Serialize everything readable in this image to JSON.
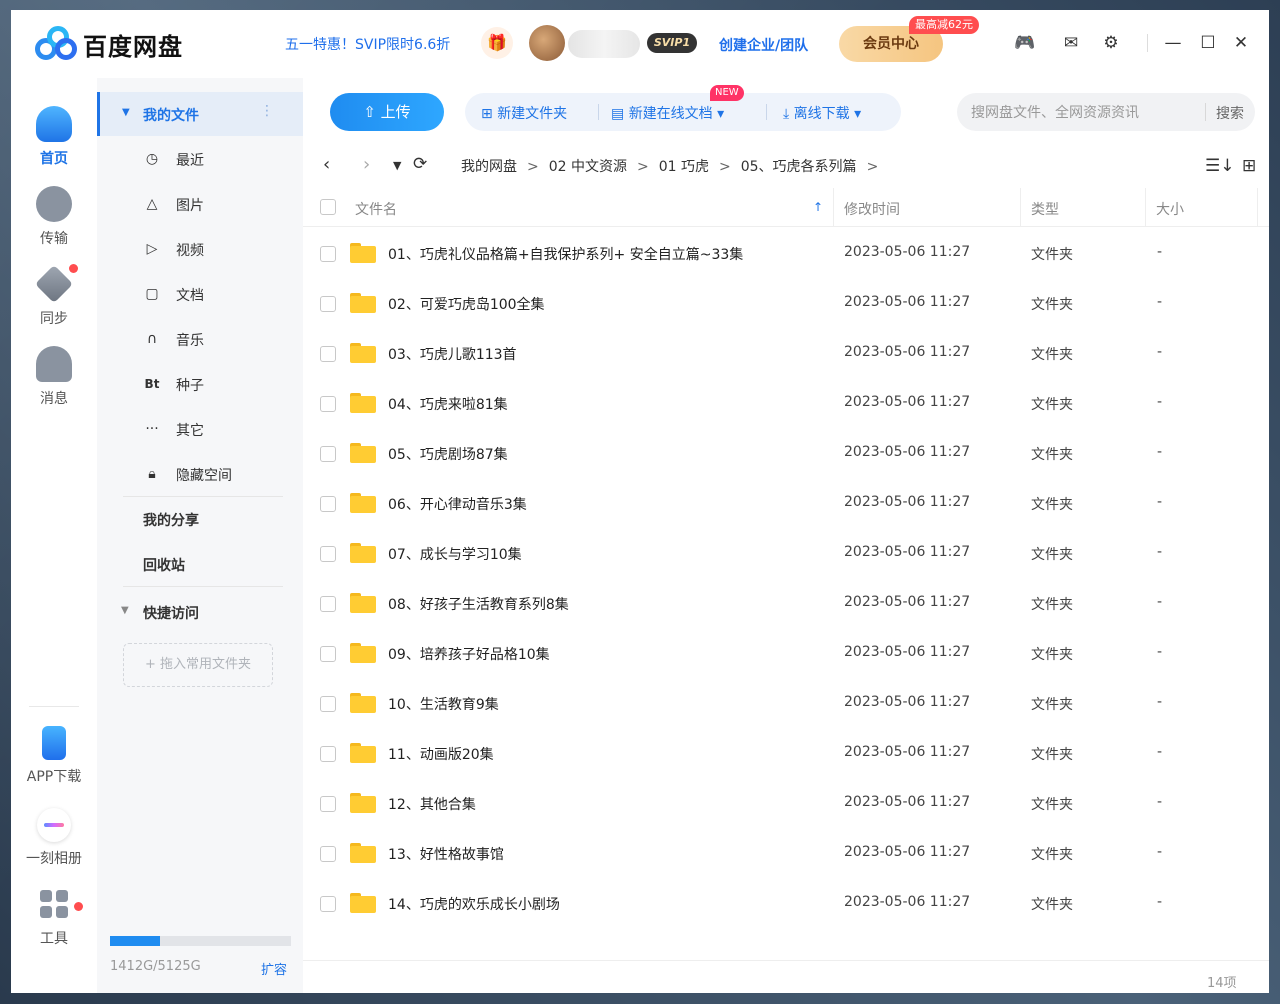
{
  "app": {
    "title": "百度网盘"
  },
  "topbar": {
    "promo": "五一特惠！SVIP限时6.6折",
    "svip_badge": "SVIP1",
    "enterprise": "创建企业/团队",
    "member_center": "会员中心",
    "member_badge": "最高减62元",
    "icons": [
      "gift-icon",
      "game-icon",
      "mail-icon",
      "gear-icon",
      "minimize-icon",
      "maximize-icon",
      "close-icon"
    ]
  },
  "leftnav": {
    "items": [
      {
        "label": "首页",
        "icon": "cloud-home-icon",
        "active": true
      },
      {
        "label": "传输",
        "icon": "transfer-icon"
      },
      {
        "label": "同步",
        "icon": "sync-icon",
        "dot": true
      },
      {
        "label": "消息",
        "icon": "users-icon"
      }
    ],
    "bottom": [
      {
        "label": "APP下载",
        "icon": "phone-icon"
      },
      {
        "label": "一刻相册",
        "icon": "album-icon"
      },
      {
        "label": "工具",
        "icon": "tools-grid-icon",
        "dot": true
      }
    ]
  },
  "sidebar": {
    "my_files": "我的文件",
    "categories": [
      {
        "label": "最近",
        "icon": "clock-icon"
      },
      {
        "label": "图片",
        "icon": "image-icon"
      },
      {
        "label": "视频",
        "icon": "video-play-icon"
      },
      {
        "label": "文档",
        "icon": "document-icon"
      },
      {
        "label": "音乐",
        "icon": "headphones-icon"
      },
      {
        "label": "种子",
        "icon": "bt-icon"
      },
      {
        "label": "其它",
        "icon": "more-dots-icon"
      },
      {
        "label": "隐藏空间",
        "icon": "lock-icon"
      }
    ],
    "my_share": "我的分享",
    "recycle": "回收站",
    "quick_access": "快捷访问",
    "dropzone": "+ 拖入常用文件夹",
    "storage_text": "1412G/5125G",
    "storage_used_fraction": 0.275,
    "expand": "扩容"
  },
  "toolbar": {
    "upload": "上传",
    "new_folder": "新建文件夹",
    "new_online_doc": "新建在线文档",
    "new_badge": "NEW",
    "offline_download": "离线下载",
    "search_placeholder": "搜网盘文件、全网资源资讯",
    "search_button": "搜索"
  },
  "breadcrumb": [
    "我的网盘",
    "02 中文资源",
    "01 巧虎",
    "05、巧虎各系列篇"
  ],
  "table": {
    "headers": {
      "name": "文件名",
      "time": "修改时间",
      "type": "类型",
      "size": "大小"
    },
    "rows": [
      {
        "name": "01、巧虎礼仪品格篇+自我保护系列+ 安全自立篇~33集",
        "time": "2023-05-06 11:27",
        "type": "文件夹",
        "size": "-"
      },
      {
        "name": "02、可爱巧虎岛100全集",
        "time": "2023-05-06 11:27",
        "type": "文件夹",
        "size": "-"
      },
      {
        "name": "03、巧虎儿歌113首",
        "time": "2023-05-06 11:27",
        "type": "文件夹",
        "size": "-"
      },
      {
        "name": "04、巧虎来啦81集",
        "time": "2023-05-06 11:27",
        "type": "文件夹",
        "size": "-"
      },
      {
        "name": "05、巧虎剧场87集",
        "time": "2023-05-06 11:27",
        "type": "文件夹",
        "size": "-"
      },
      {
        "name": "06、开心律动音乐3集",
        "time": "2023-05-06 11:27",
        "type": "文件夹",
        "size": "-"
      },
      {
        "name": "07、成长与学习10集",
        "time": "2023-05-06 11:27",
        "type": "文件夹",
        "size": "-"
      },
      {
        "name": "08、好孩子生活教育系列8集",
        "time": "2023-05-06 11:27",
        "type": "文件夹",
        "size": "-"
      },
      {
        "name": "09、培养孩子好品格10集",
        "time": "2023-05-06 11:27",
        "type": "文件夹",
        "size": "-"
      },
      {
        "name": "10、生活教育9集",
        "time": "2023-05-06 11:27",
        "type": "文件夹",
        "size": "-"
      },
      {
        "name": "11、动画版20集",
        "time": "2023-05-06 11:27",
        "type": "文件夹",
        "size": "-"
      },
      {
        "name": "12、其他合集",
        "time": "2023-05-06 11:27",
        "type": "文件夹",
        "size": "-"
      },
      {
        "name": "13、好性格故事馆",
        "time": "2023-05-06 11:27",
        "type": "文件夹",
        "size": "-"
      },
      {
        "name": "14、巧虎的欢乐成长小剧场",
        "time": "2023-05-06 11:27",
        "type": "文件夹",
        "size": "-"
      }
    ]
  },
  "footer": {
    "count": "14项"
  }
}
